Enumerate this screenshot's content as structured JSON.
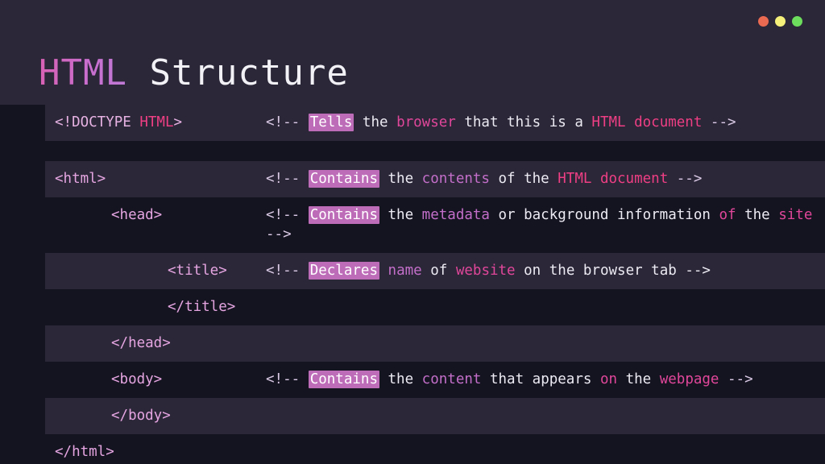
{
  "window": {
    "controls": [
      {
        "name": "close",
        "color": "#ea6a51"
      },
      {
        "name": "minimize",
        "color": "#f4f07a"
      },
      {
        "name": "maximize",
        "color": "#6ddd5d"
      }
    ]
  },
  "header": {
    "title_keyword": "HTML",
    "title_rest": " Structure"
  },
  "code": {
    "rows": [
      {
        "id": "doctype",
        "stripe": true,
        "tag_tokens": [
          {
            "text": "<!DOCTYPE ",
            "cls": "t-doc"
          },
          {
            "text": "HTML",
            "cls": "t-pink"
          },
          {
            "text": ">",
            "cls": "t-doc"
          }
        ],
        "comment_tokens": [
          {
            "text": "<!-- ",
            "cls": "t-arrow"
          },
          {
            "text": "Tells",
            "cls": "hl"
          },
          {
            "text": " the ",
            "cls": "t-plain"
          },
          {
            "text": "browser",
            "cls": "t-magenta"
          },
          {
            "text": " that this is a ",
            "cls": "t-plain"
          },
          {
            "text": "HTML document",
            "cls": "t-pink"
          },
          {
            "text": " -->",
            "cls": "t-arrow"
          }
        ]
      },
      {
        "id": "html-open",
        "stripe": true,
        "tag_tokens": [
          {
            "text": "<html>",
            "cls": "t-tag"
          }
        ],
        "comment_tokens": [
          {
            "text": "<!-- ",
            "cls": "t-arrow"
          },
          {
            "text": "Contains",
            "cls": "hl"
          },
          {
            "text": " the ",
            "cls": "t-plain"
          },
          {
            "text": "contents",
            "cls": "t-mauve"
          },
          {
            "text": " of the ",
            "cls": "t-plain"
          },
          {
            "text": "HTML document",
            "cls": "t-pink"
          },
          {
            "text": " -->",
            "cls": "t-arrow"
          }
        ]
      },
      {
        "id": "head-open",
        "stripe": false,
        "indent": 1,
        "tag_tokens": [
          {
            "text": "<head>",
            "cls": "t-tag"
          }
        ],
        "comment_tokens": [
          {
            "text": "<!-- ",
            "cls": "t-arrow"
          },
          {
            "text": "Contains",
            "cls": "hl"
          },
          {
            "text": " the ",
            "cls": "t-plain"
          },
          {
            "text": "metadata",
            "cls": "t-mauve"
          },
          {
            "text": " or background information ",
            "cls": "t-plain"
          },
          {
            "text": "of",
            "cls": "t-magenta"
          },
          {
            "text": " the ",
            "cls": "t-plain"
          },
          {
            "text": "site",
            "cls": "t-magenta"
          },
          {
            "text": " -->",
            "cls": "t-arrow"
          }
        ]
      },
      {
        "id": "title-open",
        "stripe": true,
        "indent": 2,
        "tag_tokens": [
          {
            "text": "<title>",
            "cls": "t-tag"
          }
        ],
        "comment_tokens": [
          {
            "text": "<!-- ",
            "cls": "t-arrow"
          },
          {
            "text": "Declares",
            "cls": "hl"
          },
          {
            "text": " ",
            "cls": "t-plain"
          },
          {
            "text": "name",
            "cls": "t-mauve"
          },
          {
            "text": " of ",
            "cls": "t-plain"
          },
          {
            "text": "website",
            "cls": "t-magenta"
          },
          {
            "text": " on the browser tab -->",
            "cls": "t-plain"
          }
        ]
      },
      {
        "id": "title-close",
        "stripe": false,
        "indent": 2,
        "tag_tokens": [
          {
            "text": "</title>",
            "cls": "t-tag"
          }
        ],
        "comment_tokens": []
      },
      {
        "id": "head-close",
        "stripe": true,
        "indent": 1,
        "tag_tokens": [
          {
            "text": "</head>",
            "cls": "t-tag"
          }
        ],
        "comment_tokens": []
      },
      {
        "id": "body-open",
        "stripe": false,
        "indent": 1,
        "tag_tokens": [
          {
            "text": "<body>",
            "cls": "t-tag"
          }
        ],
        "comment_tokens": [
          {
            "text": "<!-- ",
            "cls": "t-arrow"
          },
          {
            "text": "Contains",
            "cls": "hl"
          },
          {
            "text": " the ",
            "cls": "t-plain"
          },
          {
            "text": "content",
            "cls": "t-mauve"
          },
          {
            "text": " that appears ",
            "cls": "t-plain"
          },
          {
            "text": "on",
            "cls": "t-magenta"
          },
          {
            "text": " the ",
            "cls": "t-plain"
          },
          {
            "text": "webpage",
            "cls": "t-magenta"
          },
          {
            "text": " -->",
            "cls": "t-arrow"
          }
        ]
      },
      {
        "id": "body-close",
        "stripe": true,
        "indent": 1,
        "tag_tokens": [
          {
            "text": "</body>",
            "cls": "t-tag"
          }
        ],
        "comment_tokens": []
      },
      {
        "id": "html-close",
        "stripe": false,
        "indent": 0,
        "tag_tokens": [
          {
            "text": "</html>",
            "cls": "t-tag"
          }
        ],
        "comment_tokens": []
      }
    ]
  }
}
